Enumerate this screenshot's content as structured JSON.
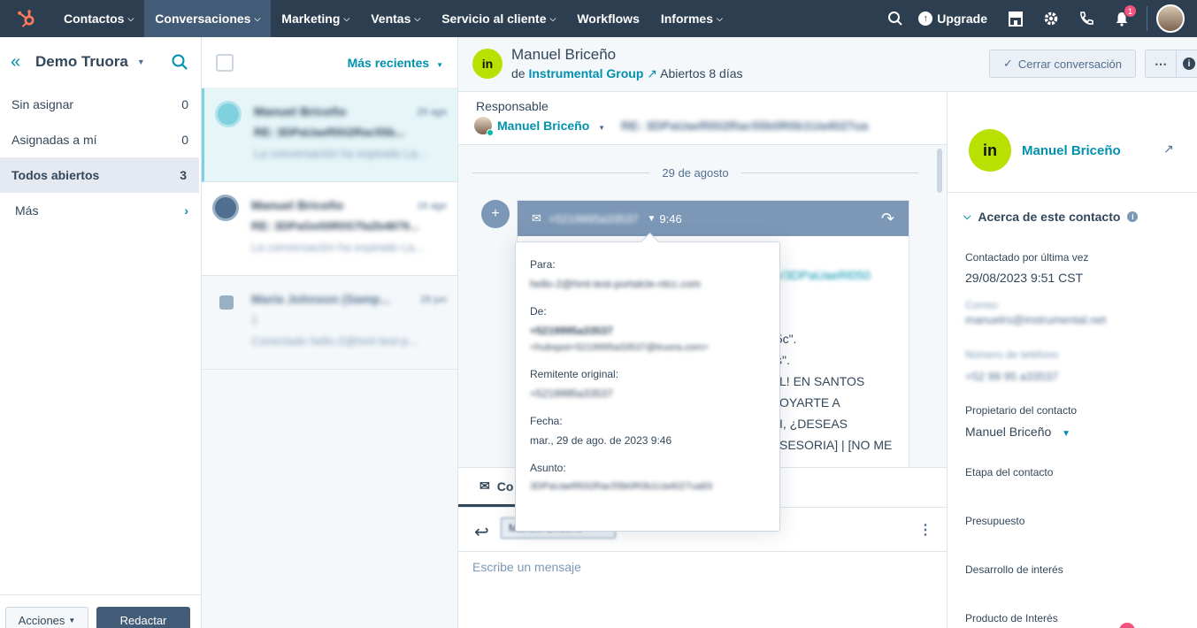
{
  "nav": {
    "items": [
      {
        "label": "Contactos",
        "dropdown": true
      },
      {
        "label": "Conversaciones",
        "dropdown": true,
        "active": true
      },
      {
        "label": "Marketing",
        "dropdown": true
      },
      {
        "label": "Ventas",
        "dropdown": true
      },
      {
        "label": "Servicio al cliente",
        "dropdown": true
      },
      {
        "label": "Workflows",
        "dropdown": false
      },
      {
        "label": "Informes",
        "dropdown": true
      }
    ],
    "upgrade_label": "Upgrade",
    "notification_count": "1",
    "brand_color": "#ff7a59"
  },
  "sidebar": {
    "title": "Demo Truora",
    "items": [
      {
        "label": "Sin asignar",
        "count": "0"
      },
      {
        "label": "Asignadas a mí",
        "count": "0"
      },
      {
        "label": "Todos abiertos",
        "count": "3"
      },
      {
        "label": "Más",
        "count": ""
      }
    ],
    "actions_label": "Acciones",
    "compose_label": "Redactar"
  },
  "list": {
    "sort_label": "Más recientes",
    "conversations": [
      {
        "name": "Manuel Briceño",
        "date": "29 ago",
        "subject": "RE: 3DPaUaeRl0i2Rac55b...",
        "preview": "La conversación ha expirado La..."
      },
      {
        "name": "Manuel Briceño",
        "date": "16 ago",
        "subject": "RE: 3DPaGe00R0S7fa2b4879...",
        "preview": "La conversación ha expirado La..."
      },
      {
        "name": "María Johnson (Samp...",
        "date": "29 jun",
        "subject": "1",
        "preview": "Conectado hello-2@hmt-test-p..."
      }
    ]
  },
  "thread": {
    "contact_name": "Manuel Briceño",
    "from_prefix": "de",
    "company": "Instrumental Group",
    "status": "Abiertos 8 días",
    "avatar_initials": "in",
    "close_label": "Cerrar conversación",
    "owner_label": "Responsable",
    "owner_name": "Manuel Briceño",
    "subject": "RE: 3DPaUaeRl0i2Rac55b0R0b1Ua4027ua",
    "date_separator": "29 de agosto",
    "email_from": "+5219995a33537",
    "email_time": "9:46",
    "body_link": "e/3DPaUaeRl050",
    "body_lines": [
      "35c\".",
      "s\".",
      "L! EN SANTOS",
      "OYARTE A",
      "I, ¿DESEAS",
      "SESORIA] | [NO ME"
    ],
    "composer_tab": "Co",
    "recipient": "Manuel Briceño",
    "message_placeholder": "Escribe un mensaje"
  },
  "popover": {
    "to_label": "Para:",
    "to_value": "hello-2@hmt-test-portalcle-ntcc.com",
    "from_label": "De:",
    "from_value": "+5219995a33537",
    "from_email": "<hubspot+5219995a33537@truora.com>",
    "original_label": "Remitente original:",
    "original_value": "+5219995a33537",
    "date_label": "Fecha:",
    "date_value": "mar., 29 de ago. de 2023 9:46",
    "subject_label": "Asunto:",
    "subject_value": "3DPaUaeRl0i2Rac55b0R0b1Ua4027ua83"
  },
  "contact": {
    "name": "Manuel Briceño",
    "avatar_initials": "in",
    "section_title": "Acerca de este contacto",
    "last_contacted_label": "Contactado por última vez",
    "last_contacted_value": "29/08/2023 9:51 CST",
    "email_label": "Correo",
    "email_value": "manuelrs@instrumental.net",
    "phone_label": "Número de teléfono",
    "phone_value": "+52 99 95 a33537",
    "owner_label": "Propietario del contacto",
    "owner_value": "Manuel Briceño",
    "stage_label": "Etapa del contacto",
    "budget_label": "Presupuesto",
    "interest_dev_label": "Desarrollo de interés",
    "interest_product_label": "Producto de Interés"
  }
}
